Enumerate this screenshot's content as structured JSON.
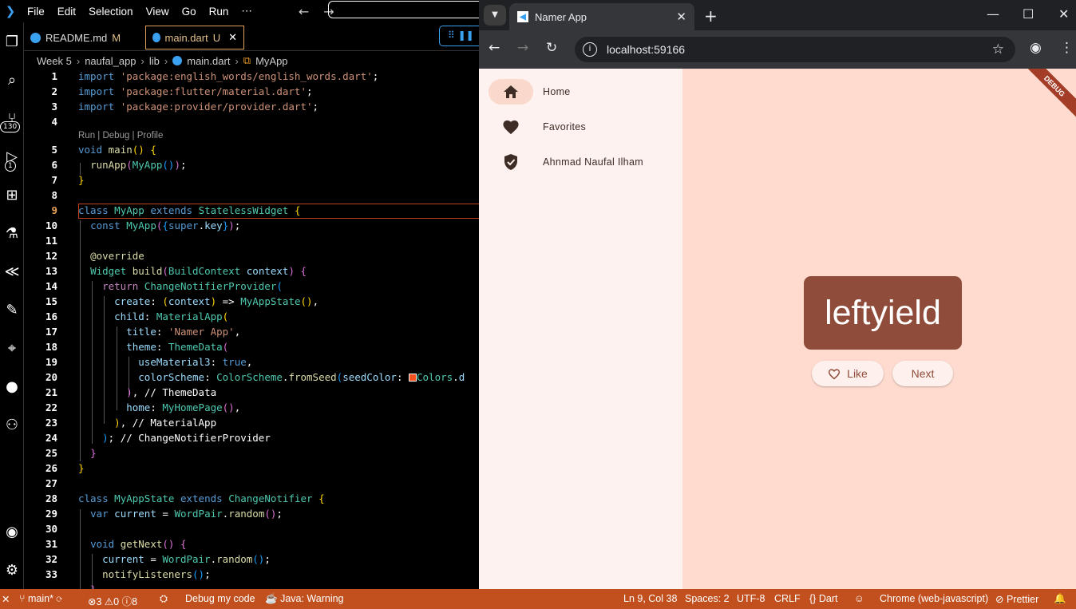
{
  "menu": {
    "items": [
      "File",
      "Edit",
      "Selection",
      "View",
      "Go",
      "Run",
      "⋯"
    ]
  },
  "activity": {
    "scm_badge": "130",
    "debug_badge": "1"
  },
  "tabs": [
    {
      "name": "README.md",
      "mark": "M"
    },
    {
      "name": "main.dart",
      "mark": "U"
    }
  ],
  "breadcrumb": [
    "Week 5",
    "naufal_app",
    "lib",
    "main.dart",
    "MyApp"
  ],
  "editor": {
    "codelens": "Run | Debug | Profile",
    "line_numbers": [
      "1",
      "2",
      "3",
      "4",
      "5",
      "6",
      "7",
      "8",
      "9",
      "10",
      "11",
      "12",
      "13",
      "14",
      "15",
      "16",
      "17",
      "18",
      "19",
      "20",
      "21",
      "22",
      "23",
      "24",
      "25",
      "26",
      "27",
      "28",
      "29",
      "30",
      "31",
      "32",
      "33"
    ],
    "current_line": "9"
  },
  "browser": {
    "tab_title": "Namer App",
    "url": "localhost:59166"
  },
  "app": {
    "destinations": [
      {
        "label": "Home",
        "icon": "home-icon",
        "selected": true
      },
      {
        "label": "Favorites",
        "icon": "heart-icon",
        "selected": false
      },
      {
        "label": "Ahnmad Naufal Ilham",
        "icon": "verified-shield-icon",
        "selected": false
      }
    ],
    "word_pair": "leftyield",
    "like_label": "Like",
    "next_label": "Next",
    "debug_banner": "DEBUG",
    "colors": {
      "primary": "#8f4c3a",
      "background": "#ffdbcf",
      "rail": "#fdf2ef"
    }
  },
  "statusbar": {
    "branch": "main*",
    "errors": "3",
    "warnings": "0",
    "info": "8",
    "debug": "Debug my code",
    "java": "Java: Warning",
    "position": "Ln 9, Col 38",
    "spaces": "Spaces: 2",
    "encoding": "UTF-8",
    "eol": "CRLF",
    "language": "Dart",
    "device": "Chrome (web-javascript)",
    "formatter": "Prettier"
  }
}
